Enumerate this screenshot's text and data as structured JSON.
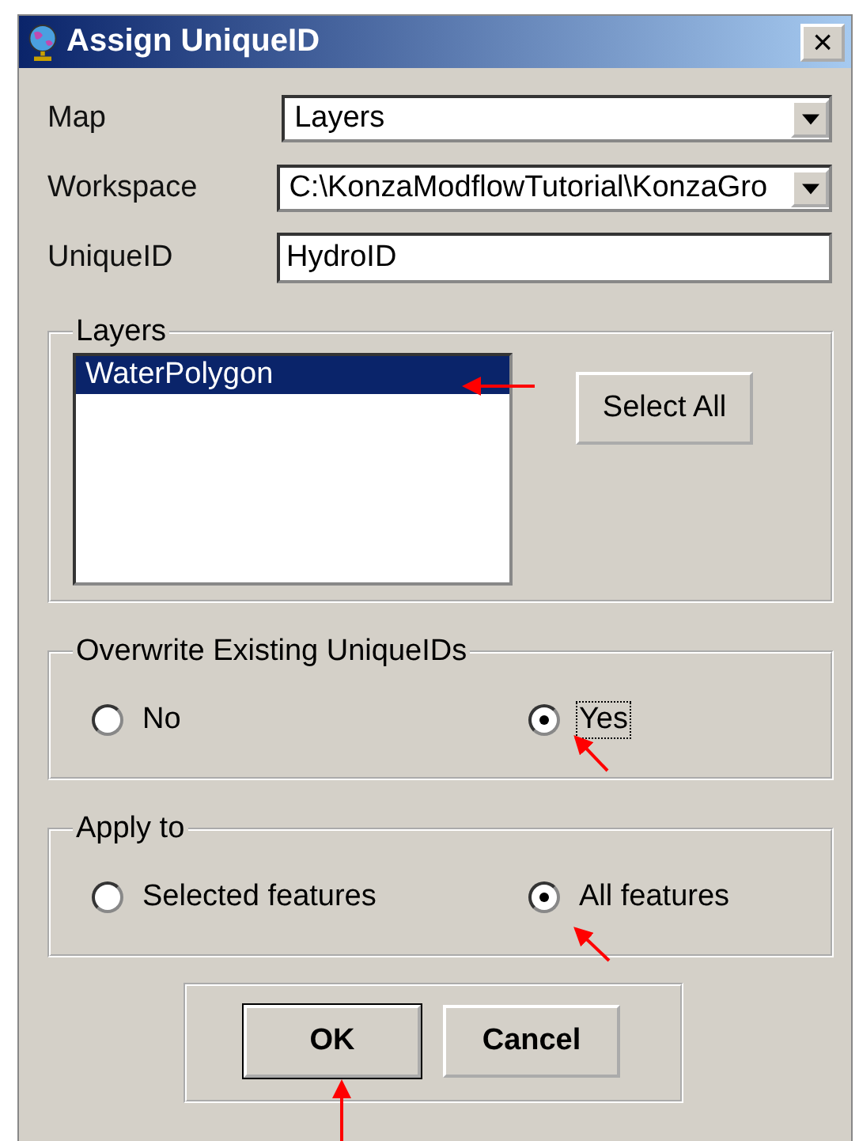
{
  "window": {
    "title": "Assign UniqueID",
    "close": "×"
  },
  "fields": [
    {
      "kind": "combo",
      "label": "Map",
      "value": "Layers"
    },
    {
      "kind": "combo",
      "label": "Workspace",
      "value": "C:\\KonzaModflowTutorial\\KonzaGro"
    },
    {
      "kind": "text",
      "label": "UniqueID",
      "value": "HydroID"
    }
  ],
  "layers": {
    "title": "Layers",
    "items": [
      {
        "label": "WaterPolygon",
        "selected": true
      }
    ],
    "button": "Select All"
  },
  "overwrite": {
    "title": "Overwrite Existing UniqueIDs",
    "options": [
      {
        "label": "No",
        "selected": false,
        "focused": false
      },
      {
        "label": "Yes",
        "selected": true,
        "focused": true
      }
    ]
  },
  "apply_to": {
    "title": "Apply to",
    "options": [
      {
        "label": "Selected features",
        "selected": false,
        "focused": false
      },
      {
        "label": "All features",
        "selected": true,
        "focused": false
      }
    ]
  },
  "buttons": [
    {
      "label": "OK",
      "default": true
    },
    {
      "label": "Cancel",
      "default": false
    }
  ]
}
